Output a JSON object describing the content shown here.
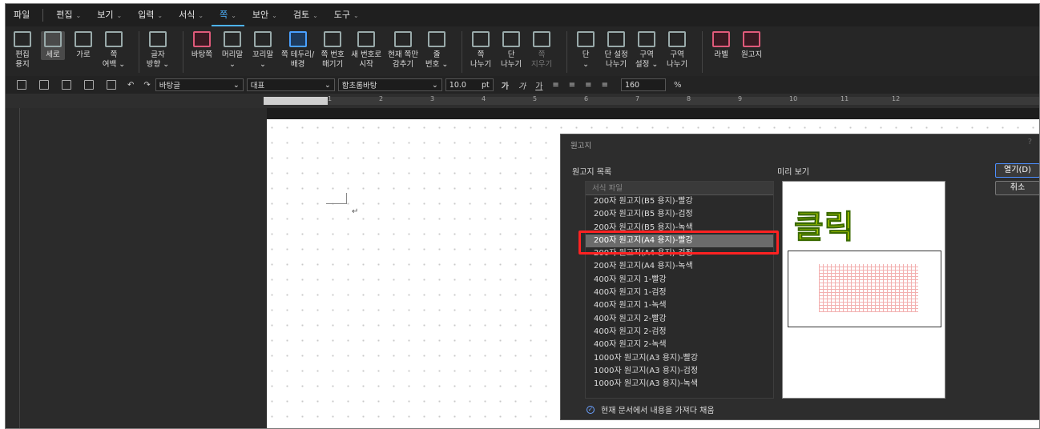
{
  "menubar": {
    "items": [
      {
        "label": "파일",
        "dd": false
      },
      {
        "label": "편집",
        "dd": true
      },
      {
        "label": "보기",
        "dd": true
      },
      {
        "label": "입력",
        "dd": true
      },
      {
        "label": "서식",
        "dd": true
      },
      {
        "label": "쪽",
        "dd": true,
        "active": true
      },
      {
        "label": "보안",
        "dd": true
      },
      {
        "label": "검토",
        "dd": true
      },
      {
        "label": "도구",
        "dd": true
      }
    ]
  },
  "ribbon": {
    "buttons": [
      {
        "label": "편집\n용지",
        "icon": "page-setup-icon"
      },
      {
        "label": "세로",
        "icon": "portrait-icon",
        "active": true
      },
      {
        "label": "가로",
        "icon": "landscape-icon"
      },
      {
        "label": "쪽\n여백 ⌄",
        "icon": "page-margin-icon"
      },
      {
        "label": "글자\n방향 ⌄",
        "icon": "text-direction-icon"
      },
      {
        "label": "바탕쪽",
        "icon": "master-page-icon"
      },
      {
        "label": "머리말\n⌄",
        "icon": "header-icon"
      },
      {
        "label": "꼬리말\n⌄",
        "icon": "footer-icon"
      },
      {
        "label": "쪽 테두리/\n배경",
        "icon": "page-border-icon"
      },
      {
        "label": "쪽 번호\n매기기",
        "icon": "page-number-icon"
      },
      {
        "label": "새 번호로\n시작",
        "icon": "new-number-icon"
      },
      {
        "label": "현재 쪽만\n감추기",
        "icon": "hide-page-icon"
      },
      {
        "label": "줄\n번호 ⌄",
        "icon": "line-number-icon"
      },
      {
        "label": "쪽\n나누기",
        "icon": "page-break-icon"
      },
      {
        "label": "단\n나누기",
        "icon": "column-break-icon"
      },
      {
        "label": "쪽\n지우기",
        "icon": "delete-page-icon",
        "dim": true
      },
      {
        "label": "단\n⌄",
        "icon": "columns-icon"
      },
      {
        "label": "단 설정\n나누기",
        "icon": "column-setting-icon"
      },
      {
        "label": "구역\n설정 ⌄",
        "icon": "section-setting-icon"
      },
      {
        "label": "구역\n나누기",
        "icon": "section-break-icon"
      },
      {
        "label": "라벨",
        "icon": "label-icon"
      },
      {
        "label": "원고지",
        "icon": "manuscript-icon"
      }
    ]
  },
  "toolbar": {
    "style": "바탕글",
    "language": "대표",
    "font": "함초롬바탕",
    "size": "10.0",
    "unit": "pt",
    "zoom": "160",
    "zoom_unit": "%",
    "bold": "가",
    "italic": "가",
    "underline": "가"
  },
  "ruler": {
    "numbers": [
      "1",
      "2",
      "3",
      "4",
      "5",
      "6",
      "7",
      "8",
      "9",
      "10",
      "11",
      "12"
    ]
  },
  "dialog": {
    "title": "원고지",
    "list_label": "원고지 목록",
    "preview_label": "미리 보기",
    "list_header": "서식 파일",
    "items": [
      "200자 원고지(B5 용지)-빨강",
      "200자 원고지(B5 용지)-검정",
      "200자 원고지(B5 용지)-녹색",
      "200자 원고지(A4 용지)-빨강",
      "200자 원고지(A4 용지)-검정",
      "200자 원고지(A4 용지)-녹색",
      "400자 원고지 1-빨강",
      "400자 원고지 1-검정",
      "400자 원고지 1-녹색",
      "400자 원고지 2-빨강",
      "400자 원고지 2-검정",
      "400자 원고지 2-녹색",
      "1000자 원고지(A3 용지)-빨강",
      "1000자 원고지(A3 용지)-검정",
      "1000자 원고지(A3 용지)-녹색"
    ],
    "selected_index": 3,
    "annotation": "클릭",
    "open_button": "열기(D)",
    "cancel_button": "취소",
    "checkbox_label": "현재 문서에서 내용을 가져다 채움",
    "checkbox_checked": true
  }
}
